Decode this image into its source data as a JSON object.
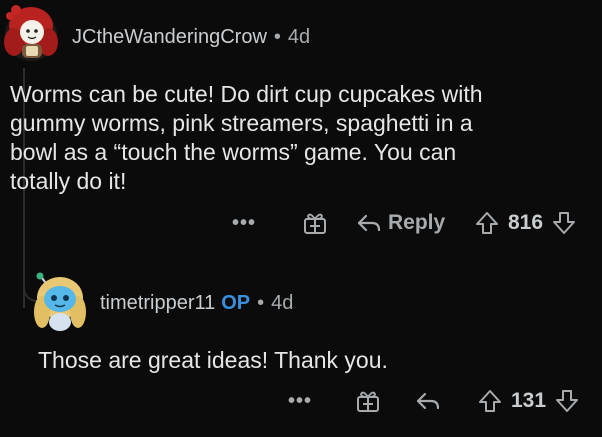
{
  "comments": [
    {
      "username": "JCtheWanderingCrow",
      "separator": "•",
      "age": "4d",
      "body": "Worms can be cute! Do dirt cup cupcakes with\ngummy worms, pink streamers, spaghetti in a\nbowl as a “touch the worms” game. You can\ntotally do it!",
      "more_label": "•••",
      "reply_label": "Reply",
      "votes": "816",
      "icons": {
        "avatar": "avatar-red-hair-girl",
        "award": "gift-icon",
        "reply": "reply-arrow-icon",
        "upvote": "upvote-arrow-icon",
        "downvote": "downvote-arrow-icon"
      }
    },
    {
      "username": "timetripper11",
      "badge": "OP",
      "separator": "•",
      "age": "4d",
      "body": "Those are great ideas! Thank you.",
      "more_label": "•••",
      "votes": "131",
      "icons": {
        "avatar": "avatar-blue-snoo",
        "award": "gift-icon",
        "reply": "reply-arrow-icon",
        "upvote": "upvote-arrow-icon",
        "downvote": "downvote-arrow-icon"
      }
    }
  ],
  "colors": {
    "background": "#0b0b0b",
    "text": "#e4e6e8",
    "muted": "#a7abae",
    "op": "#3a8fdf",
    "thread_line": "#2b2d2f"
  }
}
